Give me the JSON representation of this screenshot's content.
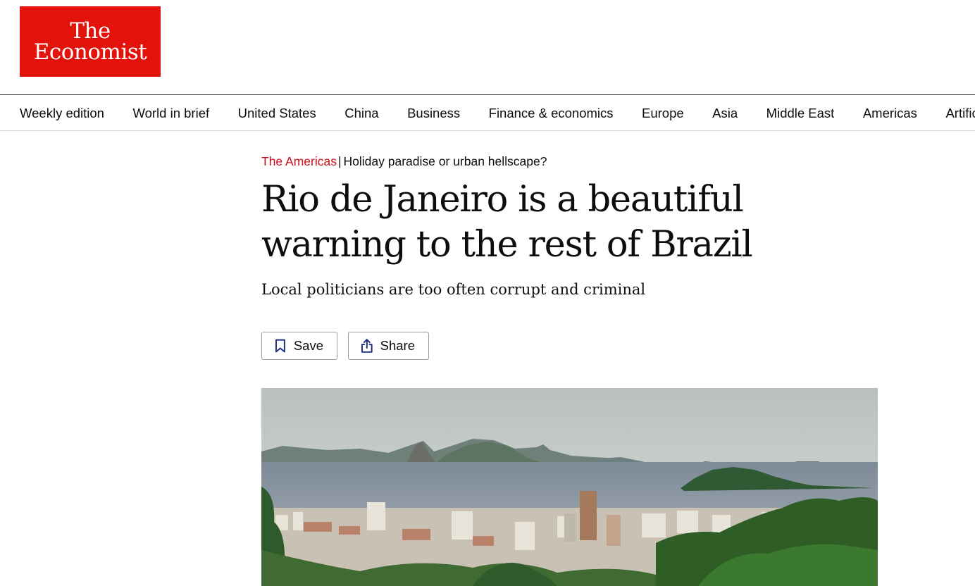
{
  "header": {
    "logo_line1": "The",
    "logo_line2": "Economist",
    "brand_color": "#e3120b"
  },
  "nav": {
    "items": [
      "Weekly edition",
      "World in brief",
      "United States",
      "China",
      "Business",
      "Finance & economics",
      "Europe",
      "Asia",
      "Middle East",
      "Americas",
      "Artific"
    ]
  },
  "article": {
    "section": "The Americas",
    "separator": "|",
    "rubric": "Holiday paradise or urban hellscape?",
    "headline": "Rio de Janeiro is a beautiful warning to the rest of Brazil",
    "subheadline": "Local politicians are too often corrupt and criminal",
    "section_color": "#c8101c"
  },
  "actions": {
    "save_label": "Save",
    "save_icon": "bookmark-icon",
    "share_label": "Share",
    "share_icon": "share-icon"
  },
  "hero_image": {
    "subject": "rio-de-janeiro-city-view"
  }
}
